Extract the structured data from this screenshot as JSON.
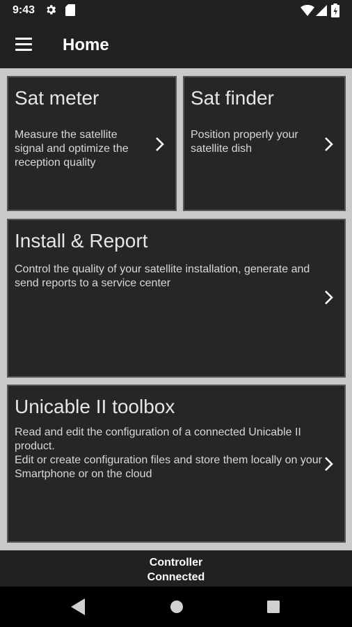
{
  "status_bar": {
    "time": "9:43",
    "icons": [
      "gear-icon",
      "sd-card-icon",
      "wifi-icon",
      "signal-icon",
      "battery-icon"
    ]
  },
  "app_bar": {
    "menu_icon": "hamburger-menu-icon",
    "title": "Home"
  },
  "cards": [
    {
      "title": "Sat meter",
      "description": "Measure the satellite signal and optimize the reception quality",
      "icon": "chevron-right-icon"
    },
    {
      "title": "Sat finder",
      "description": "Position properly your satellite dish",
      "icon": "chevron-right-icon"
    },
    {
      "title": "Install & Report",
      "description": "Control the quality of your satellite installation, generate and send reports to a service center",
      "icon": "chevron-right-icon"
    },
    {
      "title": "Unicable II toolbox",
      "description_lines": [
        "Read and edit the configuration of a connected Unicable II product.",
        "Edit or create configuration files and store them locally on your Smartphone or on the cloud"
      ],
      "icon": "chevron-right-icon"
    }
  ],
  "bottom_status": {
    "line1": "Controller",
    "line2": "Connected"
  },
  "nav_bar": {
    "icons": [
      "back-icon",
      "home-icon",
      "recents-icon"
    ]
  },
  "colors": {
    "app_bar": "#212121",
    "content_background": "#c9c9c9",
    "card_background": "#262626",
    "card_border": "#555555",
    "nav_bar": "#000000"
  }
}
